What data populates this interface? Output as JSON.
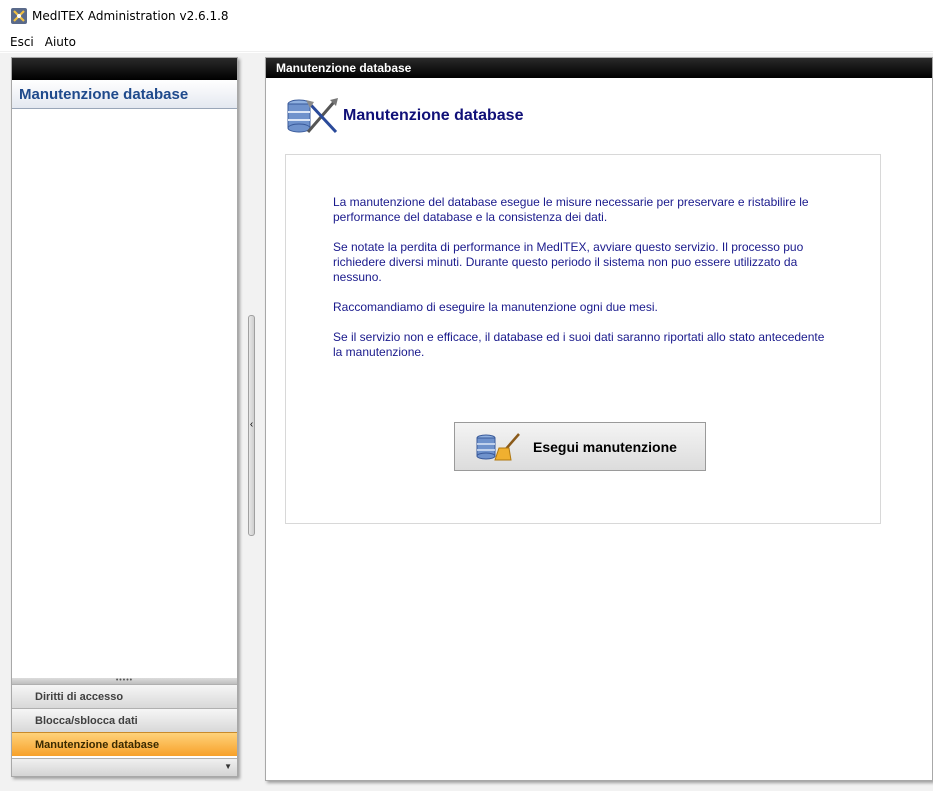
{
  "window": {
    "title": "MedITEX Administration v2.6.1.8"
  },
  "menu": {
    "items": [
      {
        "label": "Esci"
      },
      {
        "label": "Aiuto"
      }
    ]
  },
  "left_panel": {
    "header": "Manutenzione database",
    "nav_items": [
      {
        "label": "Diritti di accesso",
        "active": false
      },
      {
        "label": "Blocca/sblocca dati",
        "active": false
      },
      {
        "label": "Manutenzione database",
        "active": true
      }
    ]
  },
  "main": {
    "panel_title": "Manutenzione database",
    "heading": "Manutenzione database",
    "paragraphs": [
      "La manutenzione del database esegue le misure necessarie per preservare e ristabilire le performance del database e la consistenza dei dati.",
      "Se notate la perdita di performance in MedITEX, avviare questo servizio. Il processo puo richiedere diversi minuti. Durante questo periodo il sistema non puo essere utilizzato da nessuno.",
      "Raccomandiamo di eseguire la manutenzione ogni due mesi.",
      "Se il servizio non e efficace, il database ed i suoi dati saranno riportati allo stato antecedente la manutenzione."
    ],
    "run_button_label": "Esegui manutenzione"
  },
  "colors": {
    "accent_blue": "#1f4a8c",
    "text_navy": "#1a1a8c",
    "active_orange": "#f7a12a"
  }
}
